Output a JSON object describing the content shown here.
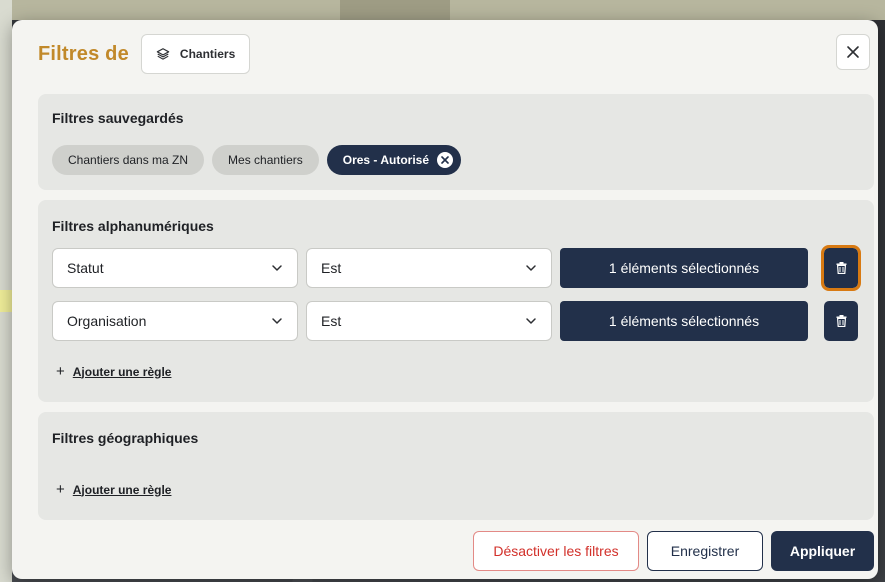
{
  "modal": {
    "title": "Filtres de",
    "layer_chip": {
      "icon": "layers-icon",
      "label": "Chantiers"
    },
    "close_icon": "close-icon"
  },
  "saved_filters": {
    "title": "Filtres sauvegardés",
    "chips": [
      {
        "label": "Chantiers dans ma ZN",
        "active": false
      },
      {
        "label": "Mes chantiers",
        "active": false
      },
      {
        "label": "Ores - Autorisé",
        "active": true
      }
    ]
  },
  "alpha_filters": {
    "title": "Filtres alphanumériques",
    "rules": [
      {
        "field": "Statut",
        "operator": "Est",
        "values_label": "1 éléments sélectionnés"
      },
      {
        "field": "Organisation",
        "operator": "Est",
        "values_label": "1 éléments sélectionnés"
      }
    ],
    "add_rule_label": "Ajouter une règle"
  },
  "geo_filters": {
    "title": "Filtres géographiques",
    "add_rule_label": "Ajouter une règle"
  },
  "footer": {
    "disable_label": "Désactiver les filtres",
    "save_label": "Enregistrer",
    "apply_label": "Appliquer"
  },
  "colors": {
    "accent_title": "#c1892a",
    "primary": "#22304a",
    "danger": "#d2302a",
    "focus_ring": "#d87a12"
  }
}
